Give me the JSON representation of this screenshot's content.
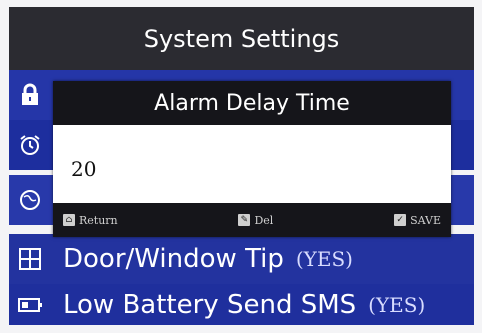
{
  "header": {
    "title": "System Settings"
  },
  "menu": {
    "items": [
      {
        "icon": "lock-icon",
        "label": "",
        "value": ""
      },
      {
        "icon": "alarm-clock-icon",
        "label": "",
        "value": ""
      },
      {
        "icon": "globe-icon",
        "label": "",
        "value": ""
      },
      {
        "icon": "door-window-icon",
        "label": "Door/Window Tip",
        "value": "(YES)"
      },
      {
        "icon": "battery-icon",
        "label": "Low Battery Send SMS",
        "value": "(YES)"
      }
    ]
  },
  "dialog": {
    "title": "Alarm Delay Time",
    "value": "20",
    "keys": [
      {
        "icon": "home-key-icon",
        "label": "Return"
      },
      {
        "icon": "delete-key-icon",
        "label": "Del"
      },
      {
        "icon": "save-key-icon",
        "label": "SAVE"
      }
    ]
  },
  "colors": {
    "title_bg": "#2b2b31",
    "menu_bg": "#1e30a2",
    "dialog_header_bg": "#15151a"
  }
}
